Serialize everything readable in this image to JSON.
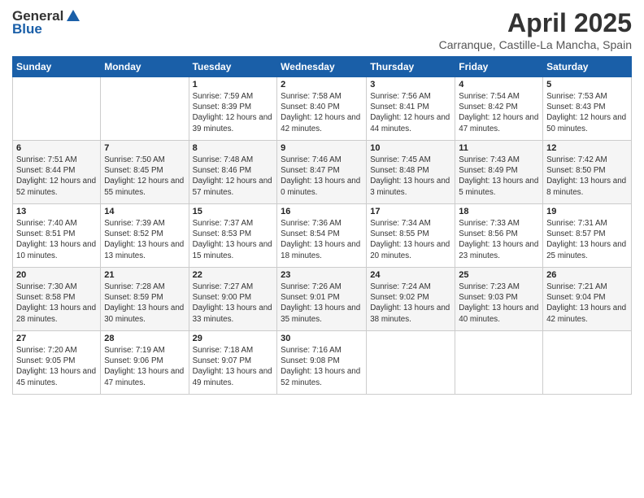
{
  "header": {
    "logo_general": "General",
    "logo_blue": "Blue",
    "title": "April 2025",
    "subtitle": "Carranque, Castille-La Mancha, Spain"
  },
  "days_of_week": [
    "Sunday",
    "Monday",
    "Tuesday",
    "Wednesday",
    "Thursday",
    "Friday",
    "Saturday"
  ],
  "weeks": [
    [
      {
        "day": "",
        "sunrise": "",
        "sunset": "",
        "daylight": ""
      },
      {
        "day": "",
        "sunrise": "",
        "sunset": "",
        "daylight": ""
      },
      {
        "day": "1",
        "sunrise": "Sunrise: 7:59 AM",
        "sunset": "Sunset: 8:39 PM",
        "daylight": "Daylight: 12 hours and 39 minutes."
      },
      {
        "day": "2",
        "sunrise": "Sunrise: 7:58 AM",
        "sunset": "Sunset: 8:40 PM",
        "daylight": "Daylight: 12 hours and 42 minutes."
      },
      {
        "day": "3",
        "sunrise": "Sunrise: 7:56 AM",
        "sunset": "Sunset: 8:41 PM",
        "daylight": "Daylight: 12 hours and 44 minutes."
      },
      {
        "day": "4",
        "sunrise": "Sunrise: 7:54 AM",
        "sunset": "Sunset: 8:42 PM",
        "daylight": "Daylight: 12 hours and 47 minutes."
      },
      {
        "day": "5",
        "sunrise": "Sunrise: 7:53 AM",
        "sunset": "Sunset: 8:43 PM",
        "daylight": "Daylight: 12 hours and 50 minutes."
      }
    ],
    [
      {
        "day": "6",
        "sunrise": "Sunrise: 7:51 AM",
        "sunset": "Sunset: 8:44 PM",
        "daylight": "Daylight: 12 hours and 52 minutes."
      },
      {
        "day": "7",
        "sunrise": "Sunrise: 7:50 AM",
        "sunset": "Sunset: 8:45 PM",
        "daylight": "Daylight: 12 hours and 55 minutes."
      },
      {
        "day": "8",
        "sunrise": "Sunrise: 7:48 AM",
        "sunset": "Sunset: 8:46 PM",
        "daylight": "Daylight: 12 hours and 57 minutes."
      },
      {
        "day": "9",
        "sunrise": "Sunrise: 7:46 AM",
        "sunset": "Sunset: 8:47 PM",
        "daylight": "Daylight: 13 hours and 0 minutes."
      },
      {
        "day": "10",
        "sunrise": "Sunrise: 7:45 AM",
        "sunset": "Sunset: 8:48 PM",
        "daylight": "Daylight: 13 hours and 3 minutes."
      },
      {
        "day": "11",
        "sunrise": "Sunrise: 7:43 AM",
        "sunset": "Sunset: 8:49 PM",
        "daylight": "Daylight: 13 hours and 5 minutes."
      },
      {
        "day": "12",
        "sunrise": "Sunrise: 7:42 AM",
        "sunset": "Sunset: 8:50 PM",
        "daylight": "Daylight: 13 hours and 8 minutes."
      }
    ],
    [
      {
        "day": "13",
        "sunrise": "Sunrise: 7:40 AM",
        "sunset": "Sunset: 8:51 PM",
        "daylight": "Daylight: 13 hours and 10 minutes."
      },
      {
        "day": "14",
        "sunrise": "Sunrise: 7:39 AM",
        "sunset": "Sunset: 8:52 PM",
        "daylight": "Daylight: 13 hours and 13 minutes."
      },
      {
        "day": "15",
        "sunrise": "Sunrise: 7:37 AM",
        "sunset": "Sunset: 8:53 PM",
        "daylight": "Daylight: 13 hours and 15 minutes."
      },
      {
        "day": "16",
        "sunrise": "Sunrise: 7:36 AM",
        "sunset": "Sunset: 8:54 PM",
        "daylight": "Daylight: 13 hours and 18 minutes."
      },
      {
        "day": "17",
        "sunrise": "Sunrise: 7:34 AM",
        "sunset": "Sunset: 8:55 PM",
        "daylight": "Daylight: 13 hours and 20 minutes."
      },
      {
        "day": "18",
        "sunrise": "Sunrise: 7:33 AM",
        "sunset": "Sunset: 8:56 PM",
        "daylight": "Daylight: 13 hours and 23 minutes."
      },
      {
        "day": "19",
        "sunrise": "Sunrise: 7:31 AM",
        "sunset": "Sunset: 8:57 PM",
        "daylight": "Daylight: 13 hours and 25 minutes."
      }
    ],
    [
      {
        "day": "20",
        "sunrise": "Sunrise: 7:30 AM",
        "sunset": "Sunset: 8:58 PM",
        "daylight": "Daylight: 13 hours and 28 minutes."
      },
      {
        "day": "21",
        "sunrise": "Sunrise: 7:28 AM",
        "sunset": "Sunset: 8:59 PM",
        "daylight": "Daylight: 13 hours and 30 minutes."
      },
      {
        "day": "22",
        "sunrise": "Sunrise: 7:27 AM",
        "sunset": "Sunset: 9:00 PM",
        "daylight": "Daylight: 13 hours and 33 minutes."
      },
      {
        "day": "23",
        "sunrise": "Sunrise: 7:26 AM",
        "sunset": "Sunset: 9:01 PM",
        "daylight": "Daylight: 13 hours and 35 minutes."
      },
      {
        "day": "24",
        "sunrise": "Sunrise: 7:24 AM",
        "sunset": "Sunset: 9:02 PM",
        "daylight": "Daylight: 13 hours and 38 minutes."
      },
      {
        "day": "25",
        "sunrise": "Sunrise: 7:23 AM",
        "sunset": "Sunset: 9:03 PM",
        "daylight": "Daylight: 13 hours and 40 minutes."
      },
      {
        "day": "26",
        "sunrise": "Sunrise: 7:21 AM",
        "sunset": "Sunset: 9:04 PM",
        "daylight": "Daylight: 13 hours and 42 minutes."
      }
    ],
    [
      {
        "day": "27",
        "sunrise": "Sunrise: 7:20 AM",
        "sunset": "Sunset: 9:05 PM",
        "daylight": "Daylight: 13 hours and 45 minutes."
      },
      {
        "day": "28",
        "sunrise": "Sunrise: 7:19 AM",
        "sunset": "Sunset: 9:06 PM",
        "daylight": "Daylight: 13 hours and 47 minutes."
      },
      {
        "day": "29",
        "sunrise": "Sunrise: 7:18 AM",
        "sunset": "Sunset: 9:07 PM",
        "daylight": "Daylight: 13 hours and 49 minutes."
      },
      {
        "day": "30",
        "sunrise": "Sunrise: 7:16 AM",
        "sunset": "Sunset: 9:08 PM",
        "daylight": "Daylight: 13 hours and 52 minutes."
      },
      {
        "day": "",
        "sunrise": "",
        "sunset": "",
        "daylight": ""
      },
      {
        "day": "",
        "sunrise": "",
        "sunset": "",
        "daylight": ""
      },
      {
        "day": "",
        "sunrise": "",
        "sunset": "",
        "daylight": ""
      }
    ]
  ]
}
